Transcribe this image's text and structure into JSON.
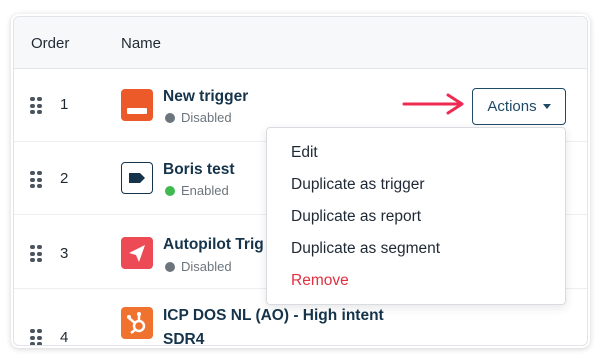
{
  "table": {
    "headers": {
      "order": "Order",
      "name": "Name"
    },
    "rows": [
      {
        "order": "1",
        "title": "New trigger",
        "status": "Disabled",
        "status_color": "#6c757d",
        "icon": "trigger-banner-icon",
        "tile_color": "#ec5a2a"
      },
      {
        "order": "2",
        "title": "Boris test",
        "status": "Enabled",
        "status_color": "#3fb950",
        "icon": "tag-icon",
        "tile_color": "#ffffff"
      },
      {
        "order": "3",
        "title": "Autopilot Trig",
        "status": "Disabled",
        "status_color": "#6c757d",
        "icon": "paper-plane-icon",
        "tile_color": "#ec4a55"
      },
      {
        "order": "4",
        "title_line1": "ICP DOS NL (AO) - High intent",
        "title_line2": "SDR4",
        "icon": "hubspot-icon",
        "tile_color": "#f0722f"
      }
    ]
  },
  "actions": {
    "label": "Actions",
    "menu": {
      "edit": "Edit",
      "duplicate_trigger": "Duplicate as trigger",
      "duplicate_report": "Duplicate as report",
      "duplicate_segment": "Duplicate as segment",
      "remove": "Remove"
    }
  },
  "colors": {
    "accent": "#1f4a66",
    "danger": "#e0303f",
    "arrow": "#ee2a52"
  }
}
